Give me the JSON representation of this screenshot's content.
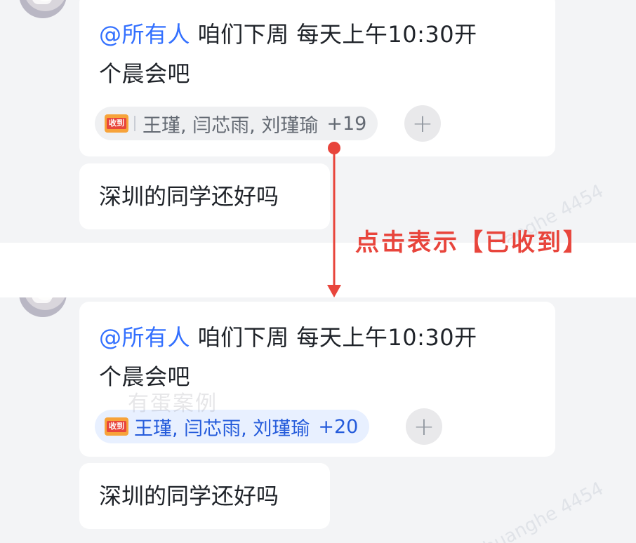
{
  "colors": {
    "mention": "#3370ff",
    "annotation": "#e8453c",
    "receipt_active": "#245bdb"
  },
  "before": {
    "message": {
      "mention": "@所有人",
      "line1_rest": " 咱们下周 每天上午10:30开",
      "line2": "个晨会吧"
    },
    "receipt": {
      "icon_label": "收到",
      "names": "王瑾, 闫芯雨, 刘瑾瑜",
      "count": "+19"
    },
    "add_button": "+",
    "followup": "深圳的同学还好吗"
  },
  "annotation": {
    "label": "点击表示【已收到】"
  },
  "after": {
    "message": {
      "mention": "@所有人",
      "line1_rest": " 咱们下周 每天上午10:30开",
      "line2": "个晨会吧"
    },
    "receipt": {
      "icon_label": "收到",
      "names": "王瑾, 闫芯雨, 刘瑾瑜",
      "count": "+20"
    },
    "add_button": "+",
    "followup": "深圳的同学还好吗"
  },
  "watermarks": {
    "case_label": "有蛋案例",
    "user_mark": "huanghe 4454"
  }
}
